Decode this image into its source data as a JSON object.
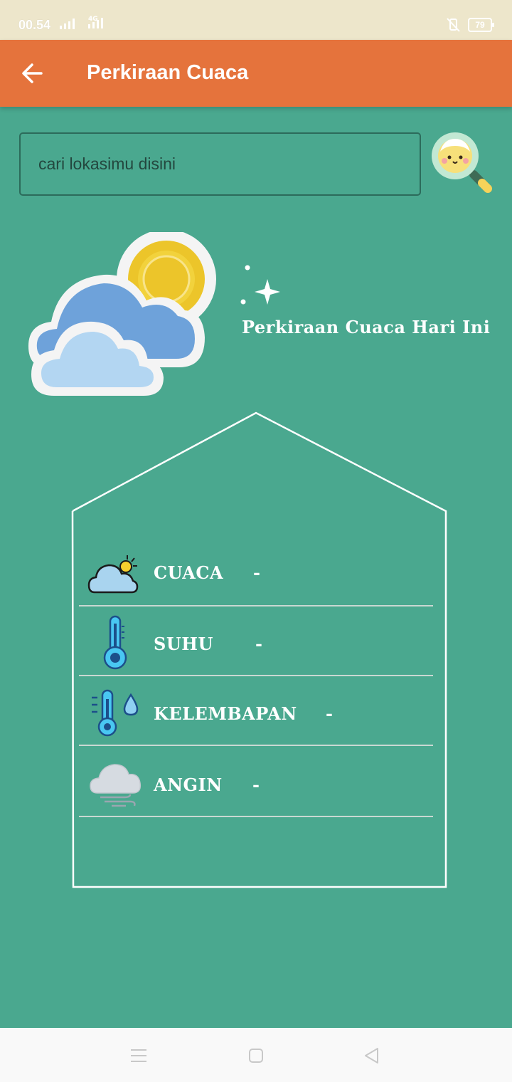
{
  "status_bar": {
    "time": "00.54",
    "network": "4G",
    "battery": "79"
  },
  "app_bar": {
    "title": "Perkiraan Cuaca",
    "back_icon": "arrow-left-icon",
    "color": "#e5733c"
  },
  "search": {
    "placeholder": "cari lokasimu disini",
    "value": "",
    "button_icon": "magnifier-face-icon"
  },
  "hero": {
    "title": "Perkiraan Cuaca Hari Ini",
    "image_icon": "sun-cloud-icon"
  },
  "weather_info": [
    {
      "label": "CUACA",
      "value": "-",
      "icon": "cloud-sun-icon"
    },
    {
      "label": "SUHU",
      "value": "-",
      "icon": "thermometer-icon"
    },
    {
      "label": "KELEMBAPAN",
      "value": "-",
      "icon": "humidity-icon"
    },
    {
      "label": "ANGIN",
      "value": "-",
      "icon": "wind-icon"
    }
  ],
  "nav": {
    "menu_icon": "menu-icon",
    "home_icon": "home-square-icon",
    "back_icon": "triangle-back-icon"
  },
  "colors": {
    "background": "#4aa88f",
    "accent": "#e5733c",
    "status_bar": "#ede6cb",
    "text": "#ffffff"
  }
}
